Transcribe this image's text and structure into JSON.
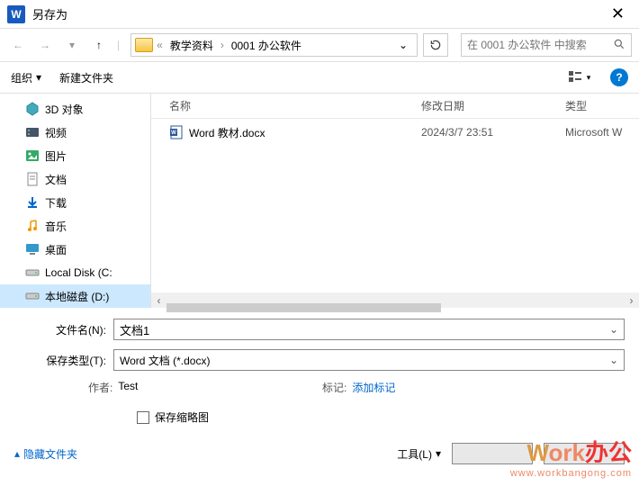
{
  "titlebar": {
    "app_letter": "W",
    "title": "另存为"
  },
  "nav": {
    "crumb1": "教学资料",
    "crumb2": "0001 办公软件",
    "search_placeholder": "在 0001 办公软件 中搜索"
  },
  "toolbar": {
    "organize": "组织",
    "new_folder": "新建文件夹"
  },
  "sidebar": {
    "items": [
      {
        "label": "3D 对象"
      },
      {
        "label": "视频"
      },
      {
        "label": "图片"
      },
      {
        "label": "文档"
      },
      {
        "label": "下载"
      },
      {
        "label": "音乐"
      },
      {
        "label": "桌面"
      },
      {
        "label": "Local Disk (C:"
      },
      {
        "label": "本地磁盘 (D:)"
      }
    ]
  },
  "filelist": {
    "headers": {
      "name": "名称",
      "date": "修改日期",
      "type": "类型"
    },
    "rows": [
      {
        "name": "Word 教材.docx",
        "date": "2024/3/7 23:51",
        "type": "Microsoft W"
      }
    ]
  },
  "form": {
    "filename_label": "文件名(N):",
    "filename_value": "文档1",
    "filetype_label": "保存类型(T):",
    "filetype_value": "Word 文档 (*.docx)",
    "author_label": "作者:",
    "author_value": "Test",
    "tags_label": "标记:",
    "tags_value": "添加标记",
    "thumbnail_label": "保存缩略图"
  },
  "footer": {
    "hide_folders": "隐藏文件夹",
    "tools": "工具(L)",
    "save": "",
    "cancel": ""
  },
  "watermark": {
    "w": "W",
    "ork": "ork",
    "cn": "办公",
    "url": "www.workbangong.com"
  }
}
